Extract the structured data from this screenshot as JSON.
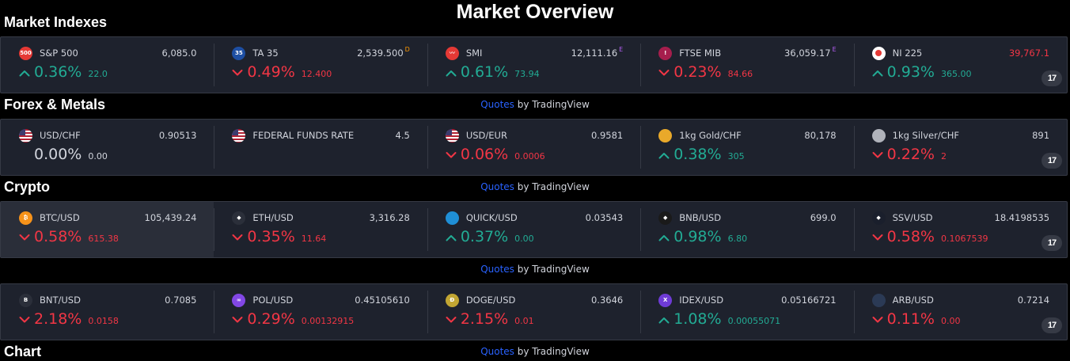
{
  "page": {
    "title": "Market Overview"
  },
  "sections": [
    {
      "title": "Market Indexes",
      "tiles": [
        {
          "symbol": "S&P 500",
          "price": "6,085.0",
          "flag": "",
          "pct": "0.36%",
          "chg": "22.0",
          "dir": "up",
          "logo_text": "500",
          "logo_color": "#e53935"
        },
        {
          "symbol": "TA 35",
          "price": "2,539.500",
          "flag": "D",
          "pct": "0.49%",
          "chg": "12.400",
          "dir": "down",
          "logo_text": "35",
          "logo_color": "#1e4fa3"
        },
        {
          "symbol": "SMI",
          "price": "12,111.16",
          "flag": "E",
          "pct": "0.61%",
          "chg": "73.94",
          "dir": "up",
          "logo_text": "〰",
          "logo_color": "#e53935"
        },
        {
          "symbol": "FTSE MIB",
          "price": "36,059.17",
          "flag": "E",
          "pct": "0.23%",
          "chg": "84.66",
          "dir": "down",
          "logo_text": "!",
          "logo_color": "#a61e4d"
        },
        {
          "symbol": "NI 225",
          "price": "39,767.1",
          "flag": "",
          "pct": "0.93%",
          "chg": "365.00",
          "dir": "up",
          "logo_text": "",
          "logo_color": "#ffffff",
          "price_red": true
        }
      ],
      "attribution": {
        "quotes": "Quotes",
        "by": " by TradingView"
      }
    },
    {
      "title": "Forex & Metals",
      "tiles": [
        {
          "symbol": "USD/CHF",
          "price": "0.90513",
          "flag": "",
          "pct": "0.00%",
          "chg": "0.00",
          "dir": "flat",
          "logo_text": "",
          "logo_color": "#3c5bb5"
        },
        {
          "symbol": "FEDERAL FUNDS RATE",
          "price": "4.5",
          "flag": "",
          "pct": "",
          "chg": "",
          "dir": "none",
          "logo_text": "",
          "logo_color": "#3c5bb5"
        },
        {
          "symbol": "USD/EUR",
          "price": "0.9581",
          "flag": "",
          "pct": "0.06%",
          "chg": "0.0006",
          "dir": "down",
          "logo_text": "",
          "logo_color": "#3c5bb5"
        },
        {
          "symbol": "1kg Gold/CHF",
          "price": "80,178",
          "flag": "",
          "pct": "0.38%",
          "chg": "305",
          "dir": "up",
          "logo_text": "",
          "logo_color": "#e9a92a"
        },
        {
          "symbol": "1kg Silver/CHF",
          "price": "891",
          "flag": "",
          "pct": "0.22%",
          "chg": "2",
          "dir": "down",
          "logo_text": "",
          "logo_color": "#b0b3bb"
        }
      ],
      "attribution": {
        "quotes": "Quotes",
        "by": " by TradingView"
      }
    },
    {
      "title": "Crypto",
      "tiles": [
        {
          "symbol": "BTC/USD",
          "price": "105,439.24",
          "flag": "",
          "pct": "0.58%",
          "chg": "615.38",
          "dir": "down",
          "logo_text": "₿",
          "logo_color": "#f7931a",
          "hover": true
        },
        {
          "symbol": "ETH/USD",
          "price": "3,316.28",
          "flag": "",
          "pct": "0.35%",
          "chg": "11.64",
          "dir": "down",
          "logo_text": "◆",
          "logo_color": "#2b2f3a"
        },
        {
          "symbol": "QUICK/USD",
          "price": "0.03543",
          "flag": "",
          "pct": "0.37%",
          "chg": "0.00",
          "dir": "up",
          "logo_text": "",
          "logo_color": "#1f8fd6"
        },
        {
          "symbol": "BNB/USD",
          "price": "699.0",
          "flag": "",
          "pct": "0.98%",
          "chg": "6.80",
          "dir": "up",
          "logo_text": "◆",
          "logo_color": "#1a1a1a"
        },
        {
          "symbol": "SSV/USD",
          "price": "18.4198535",
          "flag": "",
          "pct": "0.58%",
          "chg": "0.1067539",
          "dir": "down",
          "logo_text": "◆",
          "logo_color": "#1a1f2c"
        }
      ],
      "attribution": {
        "quotes": "Quotes",
        "by": " by TradingView"
      }
    },
    {
      "title": "",
      "tiles": [
        {
          "symbol": "BNT/USD",
          "price": "0.7085",
          "flag": "",
          "pct": "2.18%",
          "chg": "0.0158",
          "dir": "down",
          "logo_text": "B",
          "logo_color": "#2b2f3a"
        },
        {
          "symbol": "POL/USD",
          "price": "0.45105610",
          "flag": "",
          "pct": "0.29%",
          "chg": "0.00132915",
          "dir": "down",
          "logo_text": "∞",
          "logo_color": "#8247e5"
        },
        {
          "symbol": "DOGE/USD",
          "price": "0.3646",
          "flag": "",
          "pct": "2.15%",
          "chg": "0.01",
          "dir": "down",
          "logo_text": "Ð",
          "logo_color": "#c2a633"
        },
        {
          "symbol": "IDEX/USD",
          "price": "0.05166721",
          "flag": "",
          "pct": "1.08%",
          "chg": "0.00055071",
          "dir": "up",
          "logo_text": "X",
          "logo_color": "#6e3bd6"
        },
        {
          "symbol": "ARB/USD",
          "price": "0.7214",
          "flag": "",
          "pct": "0.11%",
          "chg": "0.00",
          "dir": "down",
          "logo_text": "",
          "logo_color": "#2b3a55"
        }
      ],
      "attribution": {
        "quotes": "Quotes",
        "by": " by TradingView"
      }
    }
  ],
  "footer_section": {
    "title": "Chart"
  },
  "badge": {
    "text": "17"
  },
  "colors": {
    "up": "#22ab94",
    "down": "#f23645",
    "panel": "#1e222d",
    "link": "#2962ff"
  }
}
